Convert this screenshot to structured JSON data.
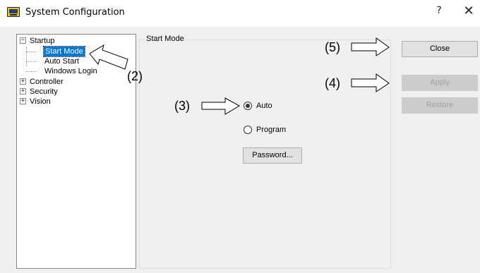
{
  "window": {
    "title": "System Configuration",
    "icon": "system-configuration-icon",
    "help_label": "?",
    "close_label": "✕"
  },
  "tree": {
    "items": [
      {
        "label": "Startup",
        "expander": "−"
      },
      {
        "label": "Start Mode",
        "selected": true
      },
      {
        "label": "Auto Start"
      },
      {
        "label": "Windows Login"
      },
      {
        "label": "Controller",
        "expander": "+"
      },
      {
        "label": "Security",
        "expander": "+"
      },
      {
        "label": "Vision",
        "expander": "+"
      }
    ]
  },
  "panel": {
    "group_label": "Start Mode",
    "radios": [
      {
        "label": "Auto",
        "checked": true
      },
      {
        "label": "Program",
        "checked": false
      }
    ],
    "password_button": "Password..."
  },
  "buttons": {
    "close": {
      "label": "Close",
      "enabled": true
    },
    "apply": {
      "label": "Apply",
      "enabled": false
    },
    "restore": {
      "label": "Restore",
      "enabled": false
    }
  },
  "callouts": {
    "c2": "(2)",
    "c3": "(3)",
    "c4": "(4)",
    "c5": "(5)"
  }
}
